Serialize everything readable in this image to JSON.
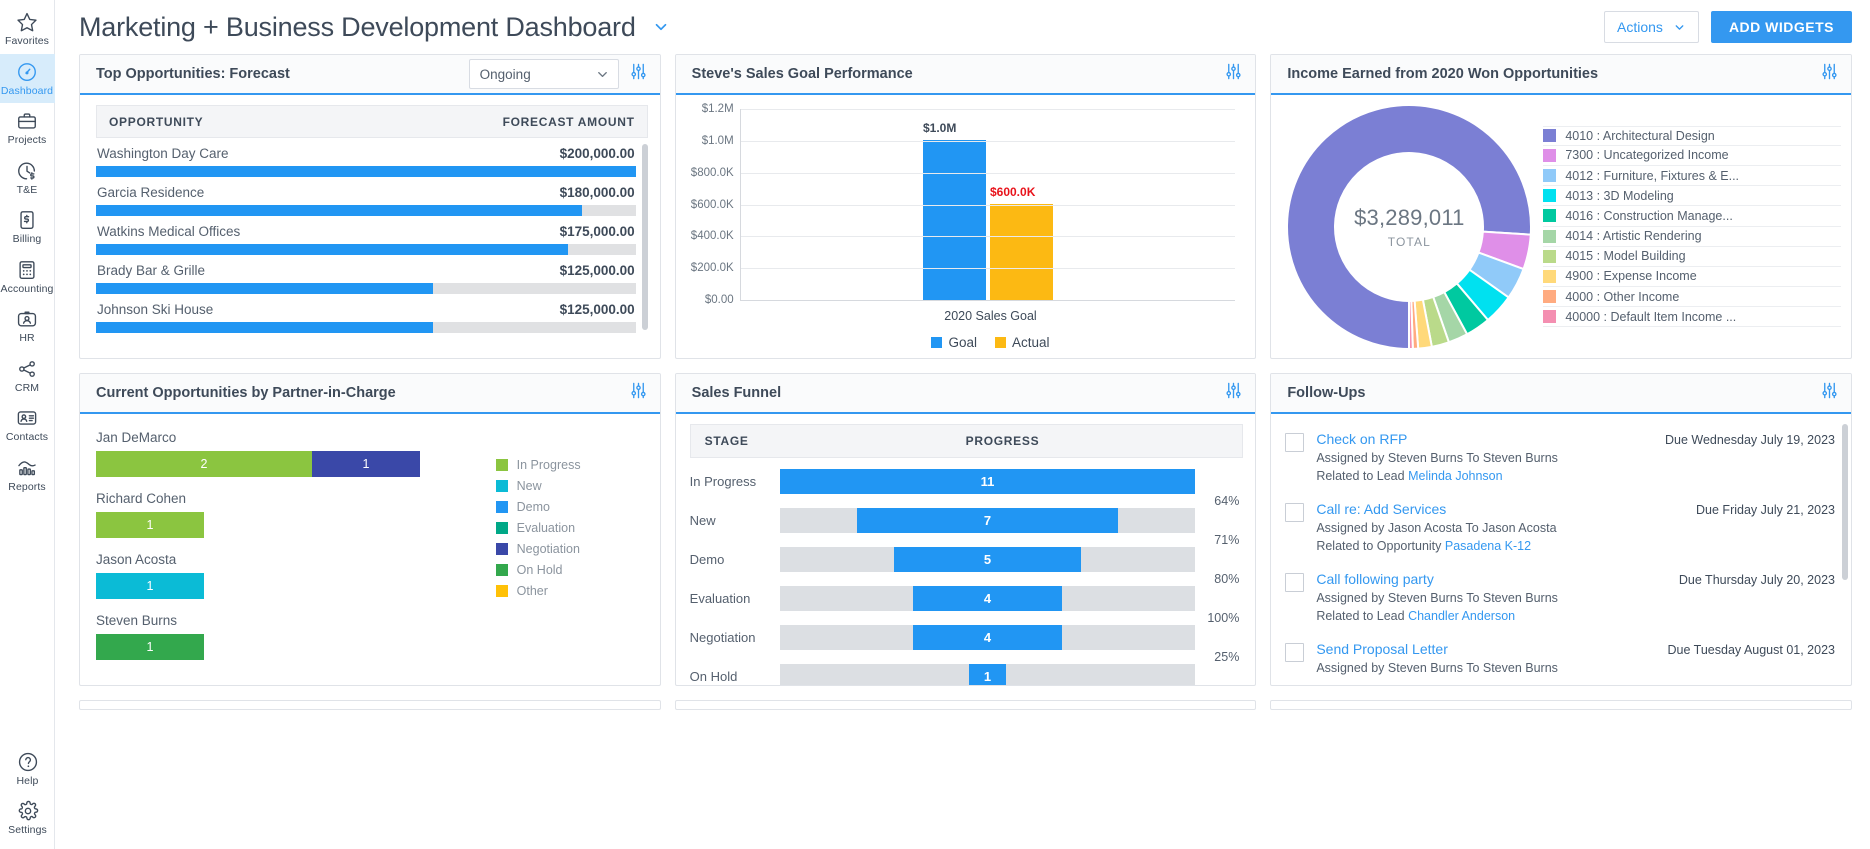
{
  "sidebar": {
    "items": [
      {
        "label": "Favorites",
        "icon": "star-icon",
        "active": false
      },
      {
        "label": "Dashboard",
        "icon": "gauge-icon",
        "active": true
      },
      {
        "label": "Projects",
        "icon": "briefcase-icon",
        "active": false
      },
      {
        "label": "T&E",
        "icon": "clock-cost-icon",
        "active": false
      },
      {
        "label": "Billing",
        "icon": "invoice-icon",
        "active": false
      },
      {
        "label": "Accounting",
        "icon": "ledger-icon",
        "active": false
      },
      {
        "label": "HR",
        "icon": "badge-icon",
        "active": false
      },
      {
        "label": "CRM",
        "icon": "network-icon",
        "active": false
      },
      {
        "label": "Contacts",
        "icon": "contact-card-icon",
        "active": false
      },
      {
        "label": "Reports",
        "icon": "bar-chart-icon",
        "active": false
      }
    ],
    "bottom": [
      {
        "label": "Help",
        "icon": "help-icon"
      },
      {
        "label": "Settings",
        "icon": "gear-icon"
      }
    ],
    "active_bg": "#d7ecfb",
    "accent": "#3498f0"
  },
  "topbar": {
    "title": "Marketing + Business Development Dashboard",
    "title_caret": "chevron-down-icon",
    "actions_label": "Actions",
    "add_widgets_label": "ADD WIDGETS",
    "accent": "#3498f0"
  },
  "widgets": {
    "top_opportunities": {
      "title": "Top Opportunities: Forecast",
      "filter_value": "Ongoing",
      "columns": [
        "OPPORTUNITY",
        "FORECAST AMOUNT"
      ],
      "bar_color": "#2196f3",
      "track_color": "#e0e1e3",
      "rows": [
        {
          "name": "Washington Day Care",
          "amount": "$200,000.00",
          "value": 200000,
          "pct": 100
        },
        {
          "name": "Garcia Residence",
          "amount": "$180,000.00",
          "value": 180000,
          "pct": 90
        },
        {
          "name": "Watkins Medical Offices",
          "amount": "$175,000.00",
          "value": 175000,
          "pct": 87.5
        },
        {
          "name": "Brady Bar & Grille",
          "amount": "$125,000.00",
          "value": 125000,
          "pct": 62.5
        },
        {
          "name": "Johnson Ski House",
          "amount": "$125,000.00",
          "value": 125000,
          "pct": 62.5
        }
      ]
    },
    "sales_goal": {
      "title": "Steve's Sales Goal Performance"
    },
    "income_donut": {
      "title": "Income Earned from 2020 Won Opportunities",
      "total": "$3,289,011",
      "total_sub": "TOTAL"
    },
    "partner_in_charge": {
      "title": "Current Opportunities by Partner-in-Charge",
      "legend": [
        {
          "label": "In Progress",
          "color": "#8bc540"
        },
        {
          "label": "New",
          "color": "#0bbbd6"
        },
        {
          "label": "Demo",
          "color": "#2196f3"
        },
        {
          "label": "Evaluation",
          "color": "#00a887"
        },
        {
          "label": "Negotiation",
          "color": "#3a48a8"
        },
        {
          "label": "On Hold",
          "color": "#33a84d"
        },
        {
          "label": "Other",
          "color": "#ffc107"
        }
      ],
      "partners": [
        {
          "name": "Jan DeMarco",
          "segments": [
            {
              "stage": "In Progress",
              "count": 2,
              "color": "#8bc540"
            },
            {
              "stage": "Negotiation",
              "count": 1,
              "color": "#3a48a8"
            }
          ]
        },
        {
          "name": "Richard Cohen",
          "segments": [
            {
              "stage": "In Progress",
              "count": 1,
              "color": "#8bc540"
            }
          ]
        },
        {
          "name": "Jason Acosta",
          "segments": [
            {
              "stage": "New",
              "count": 1,
              "color": "#0bbbd6"
            }
          ]
        },
        {
          "name": "Steven Burns",
          "segments": [
            {
              "stage": "On Hold",
              "count": 1,
              "color": "#33a84d"
            }
          ]
        }
      ]
    },
    "sales_funnel": {
      "title": "Sales Funnel",
      "columns": [
        "STAGE",
        "PROGRESS"
      ]
    },
    "follow_ups": {
      "title": "Follow-Ups",
      "items": [
        {
          "title": "Check on RFP",
          "due": "Due Wednesday July 19, 2023",
          "assigned": "Assigned by Steven Burns To Steven Burns",
          "related_prefix": "Related to Lead ",
          "related_link": "Melinda Johnson"
        },
        {
          "title": "Call re: Add Services",
          "due": "Due Friday July 21, 2023",
          "assigned": "Assigned by Jason Acosta To Jason Acosta",
          "related_prefix": "Related to Opportunity ",
          "related_link": "Pasadena K-12"
        },
        {
          "title": "Call following party",
          "due": "Due Thursday July 20, 2023",
          "assigned": "Assigned by Steven Burns To Steven Burns",
          "related_prefix": "Related to Lead ",
          "related_link": "Chandler Anderson"
        },
        {
          "title": "Send Proposal Letter",
          "due": "Due Tuesday August 01, 2023",
          "assigned": "Assigned by Steven Burns To Steven Burns",
          "related_prefix": "",
          "related_link": ""
        }
      ]
    }
  },
  "chart_data": [
    {
      "type": "bar",
      "title": "Steve's Sales Goal Performance",
      "categories": [
        "2020 Sales Goal"
      ],
      "series": [
        {
          "name": "Goal",
          "values": [
            1000000
          ],
          "color": "#2196f3",
          "label": "$1.0M",
          "label_color": "#3e4a59"
        },
        {
          "name": "Actual",
          "values": [
            600000
          ],
          "color": "#fcb913",
          "label": "$600.0K",
          "label_color": "#e8131b"
        }
      ],
      "xlabel": "2020 Sales Goal",
      "ylabel": "",
      "ylim": [
        0,
        1200000
      ],
      "yticks": [
        "$0.00",
        "$200.0K",
        "$400.0K",
        "$600.0K",
        "$800.0K",
        "$1.0M",
        "$1.2M"
      ],
      "ytick_values": [
        0,
        200000,
        400000,
        600000,
        800000,
        1000000,
        1200000
      ],
      "grid": true,
      "legend_position": "bottom"
    },
    {
      "type": "pie",
      "title": "Income Earned from 2020 Won Opportunities",
      "center_label": "$3,289,011",
      "center_sublabel": "TOTAL",
      "total": 3289011,
      "legend_position": "right",
      "slices": [
        {
          "label": "4010 : Architectural Design",
          "color": "#7b7fd4",
          "pct": 76.0
        },
        {
          "label": "7300 : Uncategorized Income",
          "color": "#df8fe8",
          "pct": 4.6
        },
        {
          "label": "4012 : Furniture, Fixtures & E...",
          "color": "#90caf9",
          "pct": 4.2
        },
        {
          "label": "4013 : 3D Modeling",
          "color": "#00e1f0",
          "pct": 4.0
        },
        {
          "label": "4016 : Construction Manage...",
          "color": "#00c9a0",
          "pct": 3.3
        },
        {
          "label": "4014 : Artistic Rendering",
          "color": "#a5d6a7",
          "pct": 2.6
        },
        {
          "label": "4015 : Model Building",
          "color": "#bada8a",
          "pct": 2.3
        },
        {
          "label": "4900 : Expense Income",
          "color": "#ffd97a",
          "pct": 1.8
        },
        {
          "label": "4000 : Other Income",
          "color": "#ffab80",
          "pct": 0.7
        },
        {
          "label": "40000 : Default Item Income ...",
          "color": "#f48fb1",
          "pct": 0.5
        }
      ]
    },
    {
      "type": "bar",
      "title": "Sales Funnel",
      "orientation": "horizontal",
      "categories": [
        "In Progress",
        "New",
        "Demo",
        "Evaluation",
        "Negotiation",
        "On Hold"
      ],
      "values": [
        11,
        7,
        5,
        4,
        4,
        1
      ],
      "widths_pct": [
        100,
        63,
        45,
        36,
        36,
        9
      ],
      "bar_color": "#2196f3",
      "track_color": "#dcdfe3",
      "conversion_labels": [
        "64%",
        "71%",
        "80%",
        "100%",
        "25%"
      ]
    },
    {
      "type": "bar",
      "title": "Current Opportunities by Partner-in-Charge",
      "orientation": "horizontal-stacked",
      "categories": [
        "Jan DeMarco",
        "Richard Cohen",
        "Jason Acosta",
        "Steven Burns"
      ],
      "series": [
        {
          "name": "In Progress",
          "values": [
            2,
            1,
            0,
            0
          ],
          "color": "#8bc540"
        },
        {
          "name": "New",
          "values": [
            0,
            0,
            1,
            0
          ],
          "color": "#0bbbd6"
        },
        {
          "name": "Negotiation",
          "values": [
            1,
            0,
            0,
            0
          ],
          "color": "#3a48a8"
        },
        {
          "name": "On Hold",
          "values": [
            0,
            0,
            0,
            1
          ],
          "color": "#33a84d"
        }
      ]
    },
    {
      "type": "bar",
      "title": "Top Opportunities: Forecast",
      "orientation": "horizontal",
      "categories": [
        "Washington Day Care",
        "Garcia Residence",
        "Watkins Medical Offices",
        "Brady Bar & Grille",
        "Johnson Ski House"
      ],
      "values": [
        200000,
        180000,
        175000,
        125000,
        125000
      ],
      "value_labels": [
        "$200,000.00",
        "$180,000.00",
        "$175,000.00",
        "$125,000.00",
        "$125,000.00"
      ],
      "bar_color": "#2196f3"
    }
  ]
}
